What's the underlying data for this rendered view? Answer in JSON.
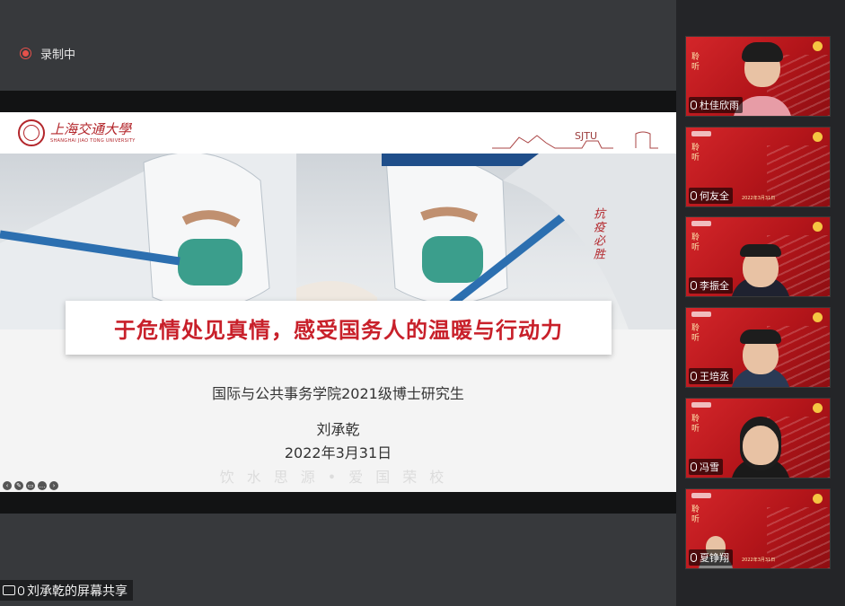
{
  "recording": {
    "label": "录制中",
    "indicator_color": "#e6514b"
  },
  "slide": {
    "university_cn": "上海交通大學",
    "university_en": "SHANGHAI JIAO TONG UNIVERSITY",
    "campus_mark": "SJTU",
    "stamp_text": "抗疫必胜",
    "title": "于危情处见真情，感受国务人的温暖与行动力",
    "school": "国际与公共事务学院2021级博士研究生",
    "presenter": "刘承乾",
    "date": "2022年3月31日",
    "motto": "饮水思源•爱国荣校",
    "title_color": "#c8202a"
  },
  "screen_share": {
    "label": "刘承乾的屏幕共享"
  },
  "participants": [
    {
      "name": "杜佳欣雨",
      "banner": "聆听",
      "caption": ""
    },
    {
      "name": "何友全",
      "banner": "聆听",
      "caption": "2022年3月31日"
    },
    {
      "name": "李振全",
      "banner": "聆听",
      "caption": ""
    },
    {
      "name": "王培丞",
      "banner": "聆听",
      "caption": ""
    },
    {
      "name": "冯雪",
      "banner": "聆听",
      "caption": ""
    },
    {
      "name": "夏铮翔",
      "banner": "聆听",
      "caption": "2022年3月31日"
    }
  ]
}
